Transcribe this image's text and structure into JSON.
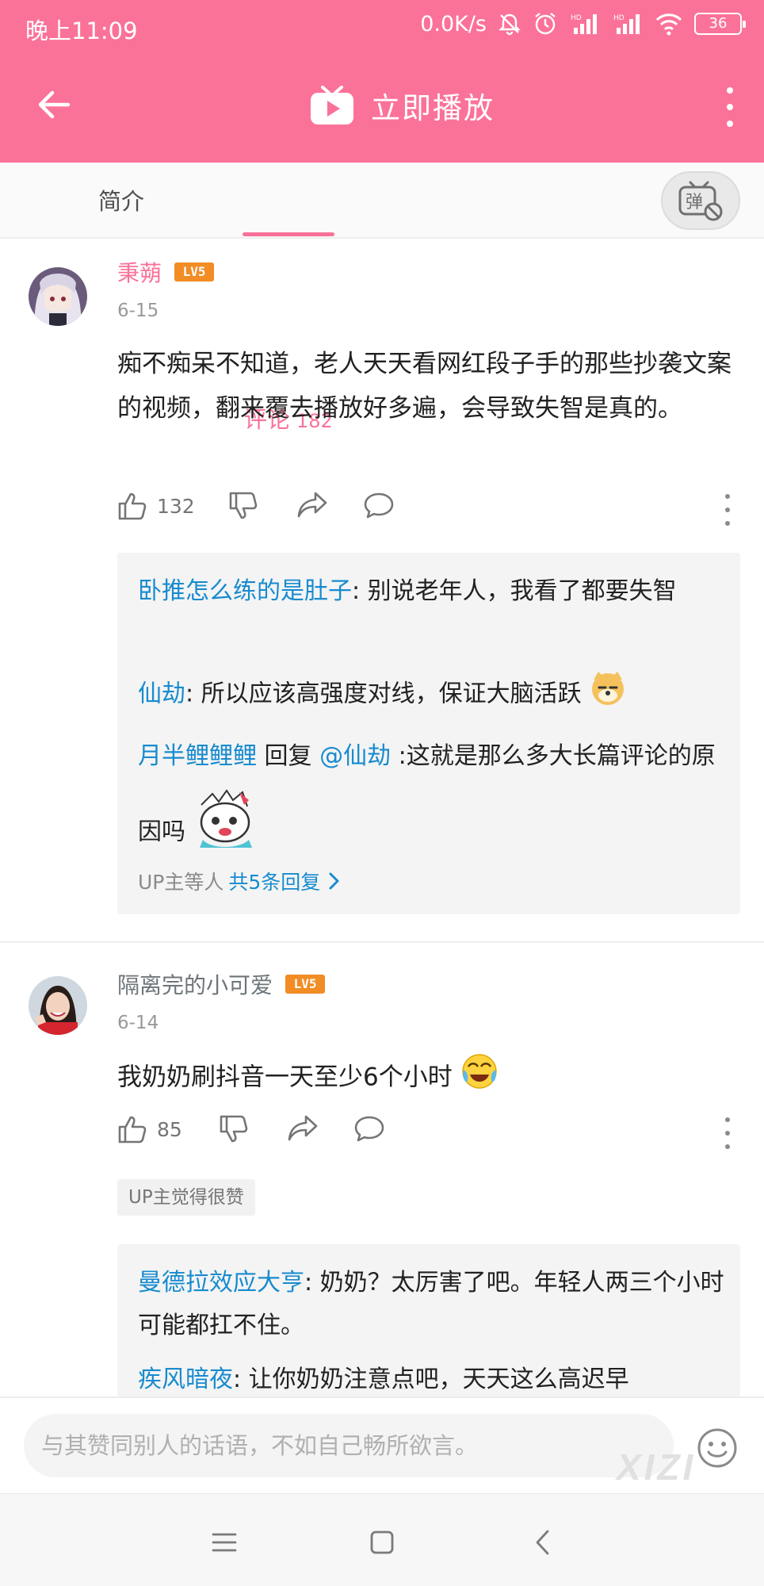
{
  "status_bar": {
    "time": "晚上11:09",
    "net_speed": "0.0K/s",
    "battery": "36"
  },
  "header": {
    "title": "立即播放",
    "bg_color": "#fb7299"
  },
  "tabs": {
    "intro": "简介",
    "comments": "评论",
    "comments_count": "182",
    "danmaku_glyph": "弹"
  },
  "comments": [
    {
      "user": "秉蒴",
      "level": "LV5",
      "date": "6-15",
      "text": "痴不痴呆不知道，老人天天看网红段子手的那些抄袭文案的视频，翻来覆去播放好多遍，会导致失智是真的。",
      "likes": "132",
      "replies": [
        {
          "user": "卧推怎么练的是肚子",
          "sep": ": ",
          "text": "别说老年人，我看了都要失智"
        },
        {
          "user": "仙劫",
          "sep": ": ",
          "text": "所以应该高强度对线，保证大脑活跃"
        },
        {
          "user": "月半鲤鲤鲤",
          "mid": " 回复 ",
          "at": "@仙劫",
          "sep": " :",
          "text": "这就是那么多大长篇评论的原因吗"
        }
      ],
      "reply_summary_prefix": "UP主等人 ",
      "reply_summary_count": "共5条回复"
    },
    {
      "user": "隔离完的小可爱",
      "level": "LV5",
      "date": "6-14",
      "text": "我奶奶刷抖音一天至少6个小时",
      "likes": "85",
      "up_tag": "UP主觉得很赞",
      "replies": [
        {
          "user": "曼德拉效应大亨",
          "sep": ": ",
          "text": "奶奶？太厉害了吧。年轻人两三个小时可能都扛不住。"
        },
        {
          "user": "疾风暗夜",
          "sep": ": ",
          "text": "让你奶奶注意点吧，天天这么高迟早"
        }
      ]
    }
  ],
  "input_bar": {
    "placeholder": "与其赞同别人的话语，不如自己畅所欲言。",
    "watermark": "XIZI"
  }
}
